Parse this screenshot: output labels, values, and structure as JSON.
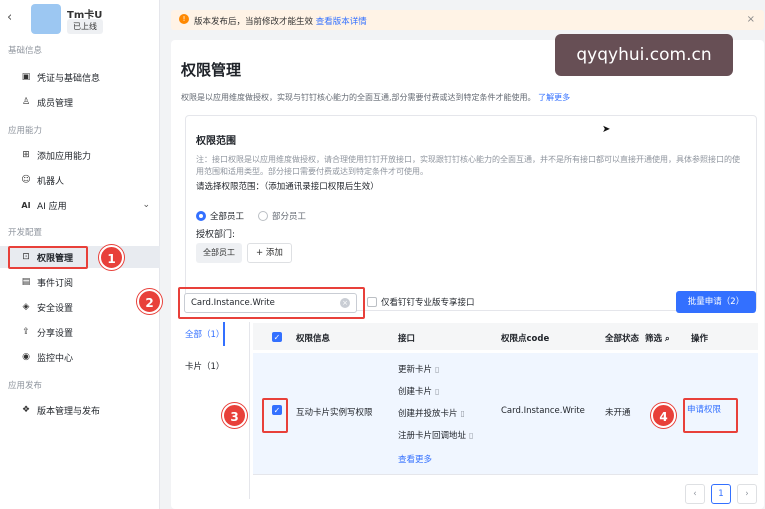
{
  "app": {
    "name": "Tm卡U",
    "status": "已上线"
  },
  "sidebar": {
    "groups": [
      {
        "title": "基础信息",
        "items": [
          {
            "icon": "document-icon",
            "label": "凭证与基础信息"
          },
          {
            "icon": "member-icon",
            "label": "成员管理"
          }
        ]
      },
      {
        "title": "应用能力",
        "items": [
          {
            "icon": "grid-add-icon",
            "label": "添加应用能力"
          },
          {
            "icon": "robot-icon",
            "label": "机器人"
          },
          {
            "icon": "ai-icon",
            "label": "AI 应用",
            "expandable": true
          }
        ]
      },
      {
        "title": "开发配置",
        "items": [
          {
            "icon": "permission-icon",
            "label": "权限管理",
            "active": true
          },
          {
            "icon": "event-icon",
            "label": "事件订阅"
          },
          {
            "icon": "shield-icon",
            "label": "安全设置"
          },
          {
            "icon": "share-icon",
            "label": "分享设置"
          },
          {
            "icon": "monitor-icon",
            "label": "监控中心"
          }
        ]
      },
      {
        "title": "应用发布",
        "items": [
          {
            "icon": "version-icon",
            "label": "版本管理与发布"
          }
        ]
      }
    ]
  },
  "banner": {
    "text": "版本发布后，当前修改才能生效",
    "link": "查看版本详情"
  },
  "page": {
    "title": "权限管理",
    "desc": "权限是以应用维度做授权，实现与钉钉核心能力的全面互通,部分需要付费或达到特定条件才能使用。",
    "desc_link": "了解更多"
  },
  "scope": {
    "title": "权限范围",
    "note": "注：接口权限是以应用维度做授权，请合理使用钉钉开放接口，实现跟钉钉核心能力的全面互通，并不是所有接口都可以直接开通使用，具体参照接口的使用范围和适用类型。部分接口需要付费或达到特定条件才可使用。",
    "choose_label": "请选择权限范围：（添加通讯录接口权限后生效）",
    "options": [
      "全部员工",
      "部分员工"
    ],
    "dept_label": "授权部门:",
    "dept_tag": "全部员工",
    "add_label": "+ 添加"
  },
  "search": {
    "value": "Card.Instance.Write"
  },
  "filter": {
    "only_pro_label": "仅看钉钉专业版专享接口"
  },
  "bulk_button": "批量申请（2）",
  "tabs": [
    {
      "label": "全部（1）"
    },
    {
      "label": "卡片（1）"
    }
  ],
  "table": {
    "headers": {
      "info": "权限信息",
      "api": "接口",
      "code": "权限点code",
      "status": "全部状态",
      "filter": "筛选",
      "action": "操作"
    },
    "row": {
      "name": "互动卡片实例写权限",
      "apis": [
        "更新卡片",
        "创建卡片",
        "创建并投放卡片",
        "注册卡片回调地址"
      ],
      "more": "查看更多",
      "code": "Card.Instance.Write",
      "status": "未开通",
      "action": "申请权限"
    }
  },
  "pager": {
    "prev": "‹",
    "current": "1",
    "next": "›"
  },
  "callouts": [
    "1",
    "2",
    "3",
    "4"
  ],
  "watermark": "qyqyhui.com.cn",
  "colors": {
    "accent": "#3370ff",
    "callout": "#e8403a",
    "banner": "#fff3e6"
  }
}
